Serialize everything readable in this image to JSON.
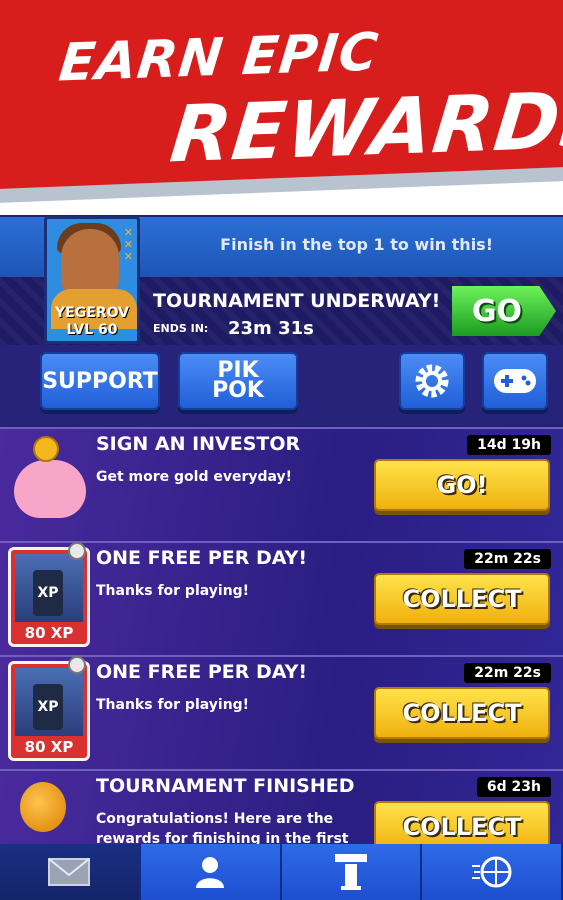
{
  "banner": {
    "line1": "EARN EPIC",
    "line2": "REWARDS!"
  },
  "tournament": {
    "info": "Finish in the top 1 to win this!",
    "player_name": "YEGEROV",
    "player_level": "LVL 60",
    "title": "TOURNAMENT UNDERWAY!",
    "ends_label": "ENDS IN:",
    "ends_value": "23m 31s",
    "go_label": "GO"
  },
  "buttons": {
    "support": "SUPPORT",
    "pik_line1": "PIK",
    "pik_line2": "POK"
  },
  "rows": [
    {
      "title": "SIGN AN INVESTOR",
      "sub": "Get more gold everyday!",
      "time": "14d 19h",
      "action": "GO!"
    },
    {
      "title": "ONE FREE PER DAY!",
      "sub": "Thanks for playing!",
      "time": "22m 22s",
      "action": "COLLECT",
      "xp": "80 XP"
    },
    {
      "title": "ONE FREE PER DAY!",
      "sub": "Thanks for playing!",
      "time": "22m 22s",
      "action": "COLLECT",
      "xp": "80 XP"
    },
    {
      "title": "TOURNAMENT FINISHED",
      "sub": "Congratulations! Here are the rewards for finishing in the first prize tier!",
      "time": "6d 23h",
      "action": "COLLECT"
    }
  ],
  "nav": {
    "icons": [
      "mail-icon",
      "profile-icon",
      "arena-icon",
      "basketball-icon"
    ],
    "active_index": 0
  },
  "colors": {
    "banner_red": "#d81d1d",
    "go_green": "#1c9b22",
    "action_yellow": "#f0b00e",
    "nav_blue": "#1d4fd0"
  }
}
